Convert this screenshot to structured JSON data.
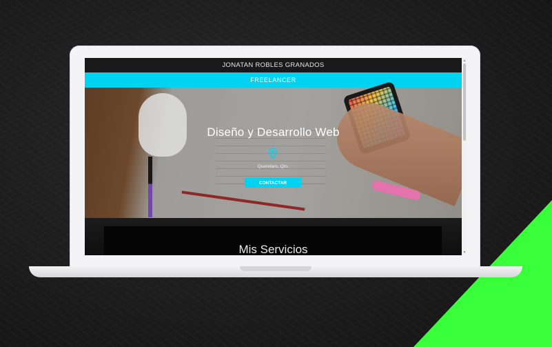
{
  "site": {
    "header_name": "JONATAN ROBLES GRANADOS",
    "banner_label": "FREELANCER",
    "hero": {
      "title": "Diseño y Desarrollo Web",
      "location": "Querétaro, Qro.",
      "cta_label": "CONTACTAR"
    },
    "services": {
      "title": "Mis Servicios"
    }
  },
  "icons": {
    "location": "location-pin-icon",
    "scroll_up": "chevron-up-icon",
    "scroll_down": "chevron-down-icon"
  },
  "colors": {
    "accent": "#00d2f2",
    "decor_green": "#39ff3b",
    "header_bg": "#191919"
  }
}
